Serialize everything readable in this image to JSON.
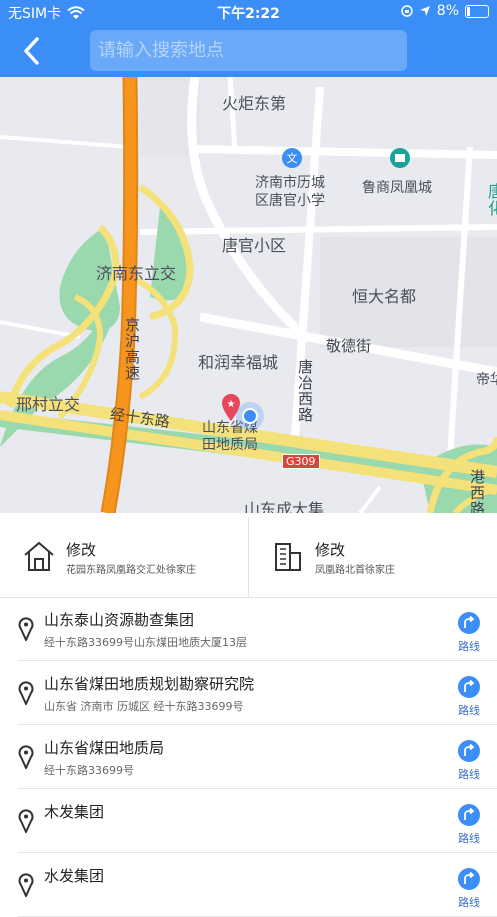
{
  "status": {
    "carrier": "无SIM卡",
    "time": "下午2:22",
    "battery": "8%"
  },
  "header": {
    "search_placeholder": "请输入搜索地点"
  },
  "map": {
    "labels": {
      "huoju": "火炬东第",
      "school": "济南市历城\n区唐官小学",
      "lushang": "鲁商凤凰城",
      "tangguan": "唐官小区",
      "ji_dong": "济南东立交",
      "hengda": "恒大名都",
      "jingde": "敬德街",
      "jinghu": "京沪高速",
      "herun": "和润幸福城",
      "tangye": "唐冶西路",
      "xingcun": "邢村立交",
      "jingshi": "经十东路",
      "bureau": "山东省煤\n田地质局",
      "g309": "G309",
      "chengda": "山东成大集",
      "gangxi": "港西路",
      "tang_right": "唐化",
      "di_right": "帝华"
    }
  },
  "locations": [
    {
      "title": "修改",
      "subtitle": "花园东路凤凰路交汇处徐家庄"
    },
    {
      "title": "修改",
      "subtitle": "凤凰路北首徐家庄"
    }
  ],
  "results": [
    {
      "name": "山东泰山资源勘查集团",
      "address": "经十东路33699号山东煤田地质大厦13层",
      "route": "路线"
    },
    {
      "name": "山东省煤田地质规划勘察研究院",
      "address": "山东省 济南市 历城区 经十东路33699号",
      "route": "路线"
    },
    {
      "name": "山东省煤田地质局",
      "address": "经十东路33699号",
      "route": "路线"
    },
    {
      "name": "木发集团",
      "address": "",
      "route": "路线"
    },
    {
      "name": "水发集团",
      "address": "",
      "route": "路线"
    }
  ],
  "colors": {
    "accent": "#3a8ef6",
    "highway": "#f7941d",
    "road_yellow": "#f5e17a",
    "green": "#7ccf9a"
  },
  "icons": {
    "back": "chevron-left-icon",
    "home": "home-icon",
    "building": "building-icon",
    "pin": "map-pin-icon",
    "route": "route-icon"
  }
}
